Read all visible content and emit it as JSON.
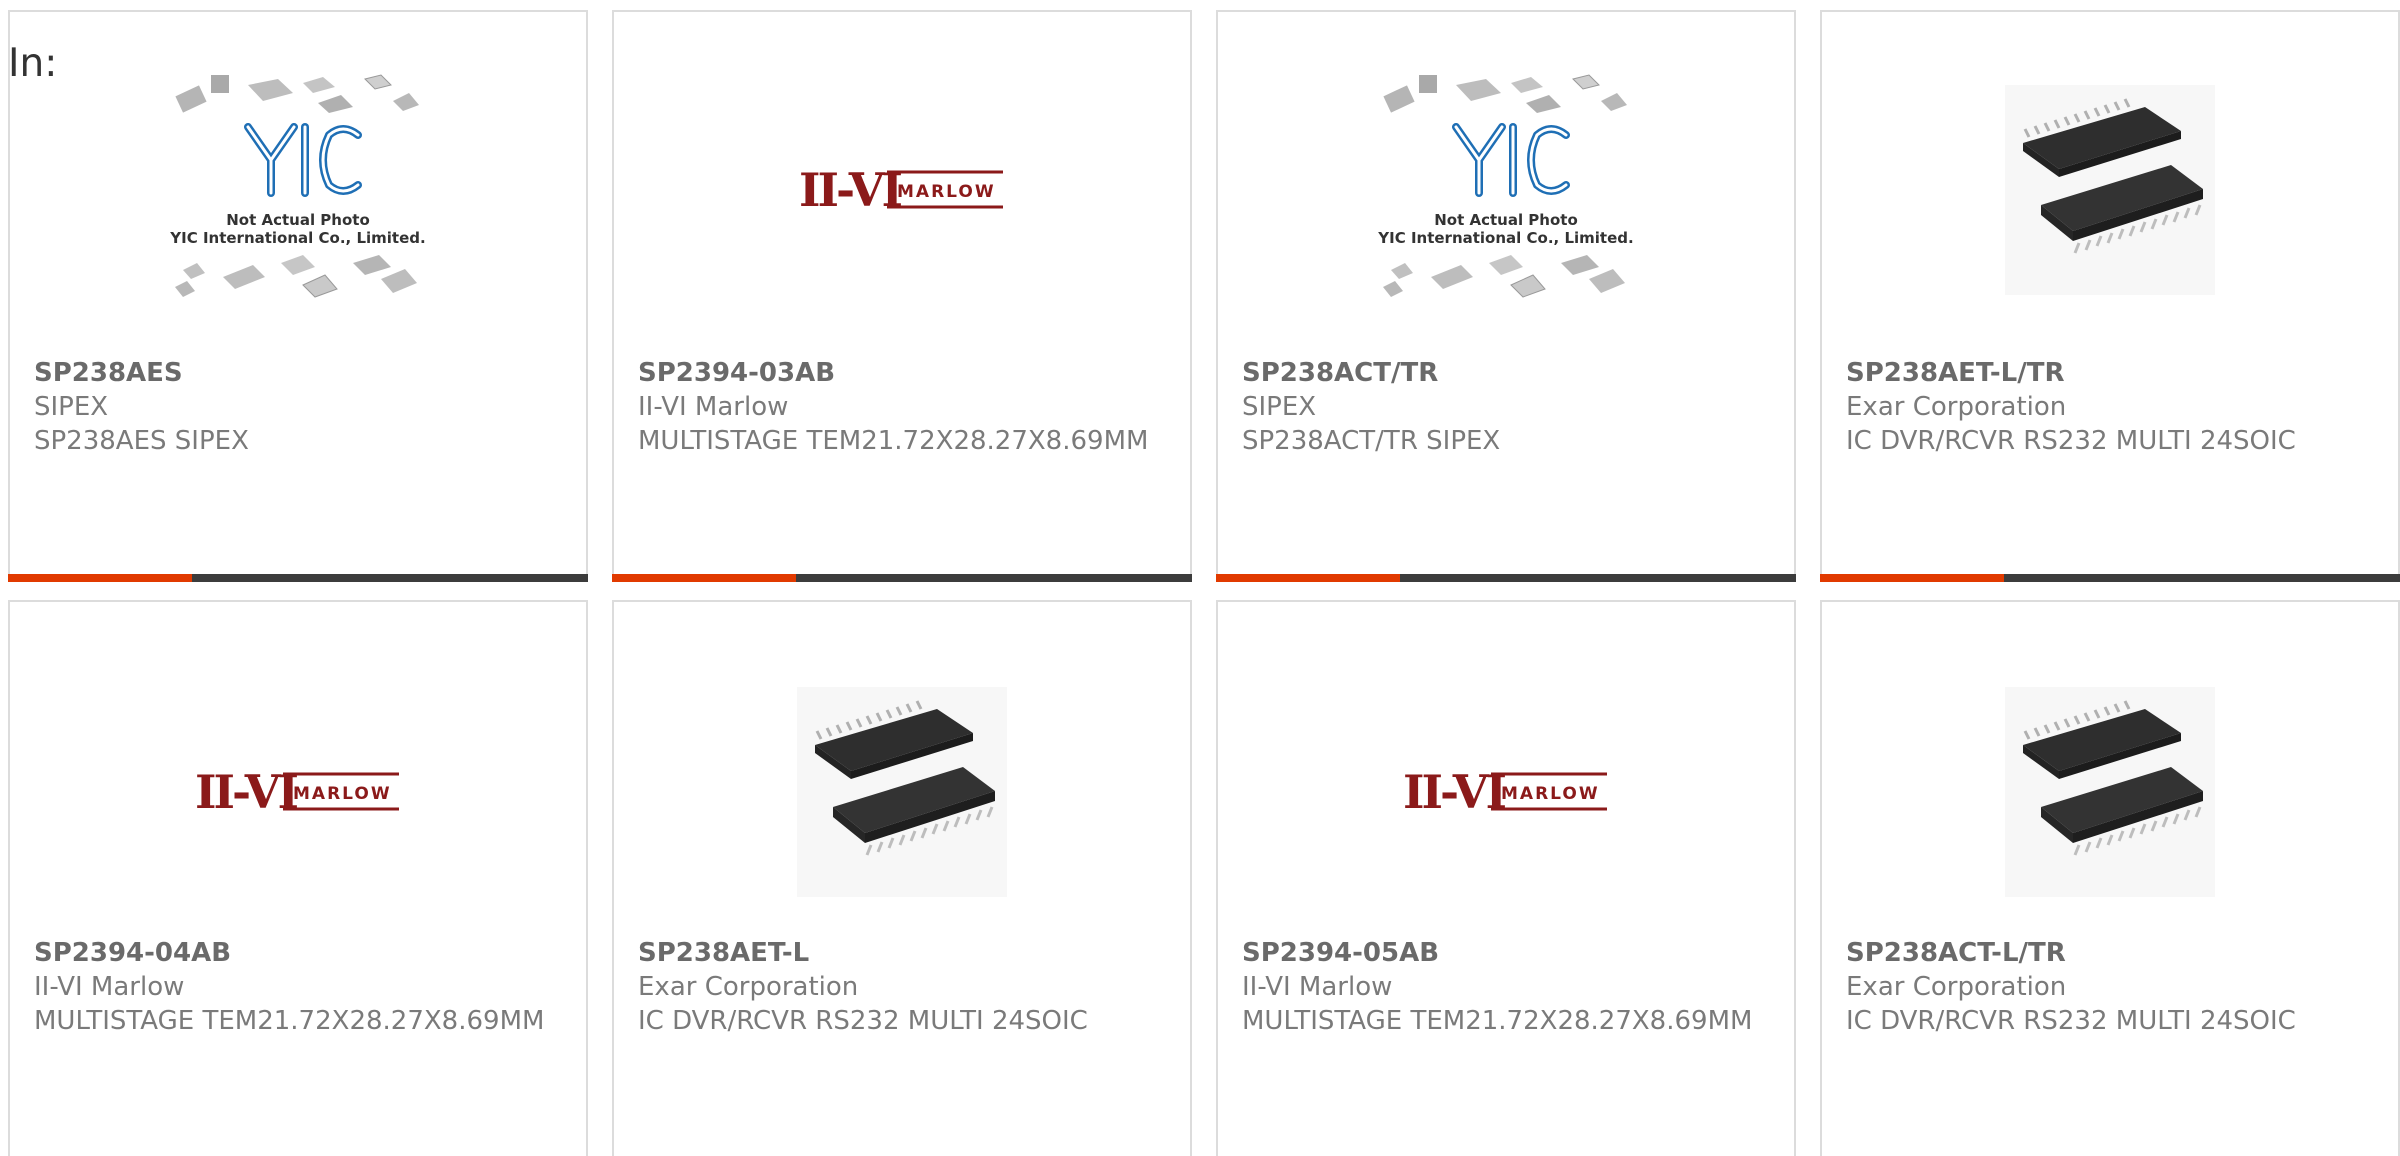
{
  "header": {
    "label": "In:"
  },
  "products": [
    {
      "part_number": "SP238AES",
      "manufacturer": "SIPEX",
      "description": "SP238AES SIPEX",
      "image": "yic-placeholder",
      "image_text": [
        "Not Actual Photo",
        "YIC International Co., Limited."
      ]
    },
    {
      "part_number": "SP2394-03AB",
      "manufacturer": "II-VI Marlow",
      "description": "MULTISTAGE TEM21.72X28.27X8.69MM",
      "image": "marlow-logo",
      "image_text": [
        "II-VI",
        "MARLOW"
      ]
    },
    {
      "part_number": "SP238ACT/TR",
      "manufacturer": "SIPEX",
      "description": "SP238ACT/TR SIPEX",
      "image": "yic-placeholder",
      "image_text": [
        "Not Actual Photo",
        "YIC International Co., Limited."
      ]
    },
    {
      "part_number": "SP238AET-L/TR",
      "manufacturer": "Exar Corporation",
      "description": "IC DVR/RCVR RS232 MULTI 24SOIC",
      "image": "soic-chips"
    },
    {
      "part_number": "SP2394-04AB",
      "manufacturer": "II-VI Marlow",
      "description": "MULTISTAGE TEM21.72X28.27X8.69MM",
      "image": "marlow-logo",
      "image_text": [
        "II-VI",
        "MARLOW"
      ]
    },
    {
      "part_number": "SP238AET-L",
      "manufacturer": "Exar Corporation",
      "description": "IC DVR/RCVR RS232 MULTI 24SOIC",
      "image": "soic-chips"
    },
    {
      "part_number": "SP2394-05AB",
      "manufacturer": "II-VI Marlow",
      "description": "MULTISTAGE TEM21.72X28.27X8.69MM",
      "image": "marlow-logo",
      "image_text": [
        "II-VI",
        "MARLOW"
      ]
    },
    {
      "part_number": "SP238ACT-L/TR",
      "manufacturer": "Exar Corporation",
      "description": "IC DVR/RCVR RS232 MULTI 24SOIC",
      "image": "soic-chips"
    }
  ],
  "colors": {
    "accent": "#e13a00",
    "bar": "#3c3c3c",
    "marlow_red": "#8b1a1a",
    "yic_blue": "#1f6fb5"
  }
}
